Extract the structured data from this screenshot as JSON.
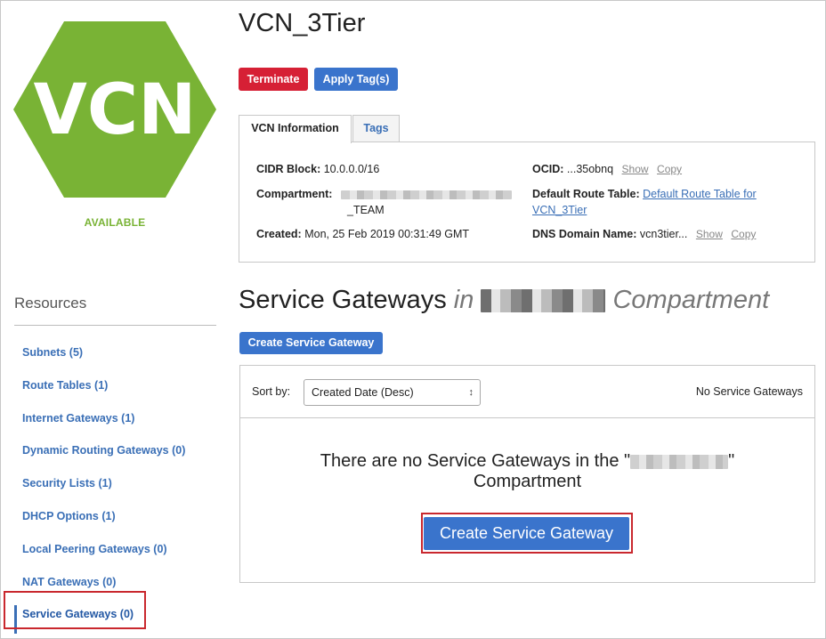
{
  "vcn": {
    "logo_text": "VCN",
    "status": "AVAILABLE",
    "title": "VCN_3Tier",
    "logo_color": "#79b335"
  },
  "actions": {
    "terminate": "Terminate",
    "apply_tags": "Apply Tag(s)"
  },
  "tabs": [
    {
      "label": "VCN Information",
      "active": true
    },
    {
      "label": "Tags",
      "active": false
    }
  ],
  "info": {
    "cidr_label": "CIDR Block:",
    "cidr_value": "10.0.0.0/16",
    "compartment_label": "Compartment:",
    "compartment_value_line2": "_TEAM",
    "created_label": "Created:",
    "created_value": "Mon, 25 Feb 2019 00:31:49 GMT",
    "ocid_label": "OCID:",
    "ocid_value": "...35obnq",
    "show": "Show",
    "copy": "Copy",
    "route_table_label": "Default Route Table:",
    "route_table_link_1": "Default Route Table for",
    "route_table_link_2": "VCN_3Tier",
    "dns_label": "DNS Domain Name:",
    "dns_value": "vcn3tier..."
  },
  "resources": {
    "title": "Resources",
    "items": [
      {
        "label": "Subnets (5)"
      },
      {
        "label": "Route Tables (1)"
      },
      {
        "label": "Internet Gateways (1)"
      },
      {
        "label": "Dynamic Routing Gateways (0)"
      },
      {
        "label": "Security Lists (1)"
      },
      {
        "label": "DHCP Options (1)"
      },
      {
        "label": "Local Peering Gateways (0)"
      },
      {
        "label": "NAT Gateways (0)"
      },
      {
        "label": "Service Gateways (0)"
      }
    ]
  },
  "section": {
    "title": "Service Gateways",
    "in_word": "in",
    "compartment_word": "Compartment",
    "create_button": "Create Service Gateway",
    "sort_label": "Sort by:",
    "sort_value": "Created Date (Desc)",
    "count_text": "No Service Gateways",
    "empty_line1_pre": "There are no Service Gateways in the \"",
    "empty_line1_post": "\"",
    "empty_line2": "Compartment",
    "empty_button": "Create Service Gateway"
  }
}
